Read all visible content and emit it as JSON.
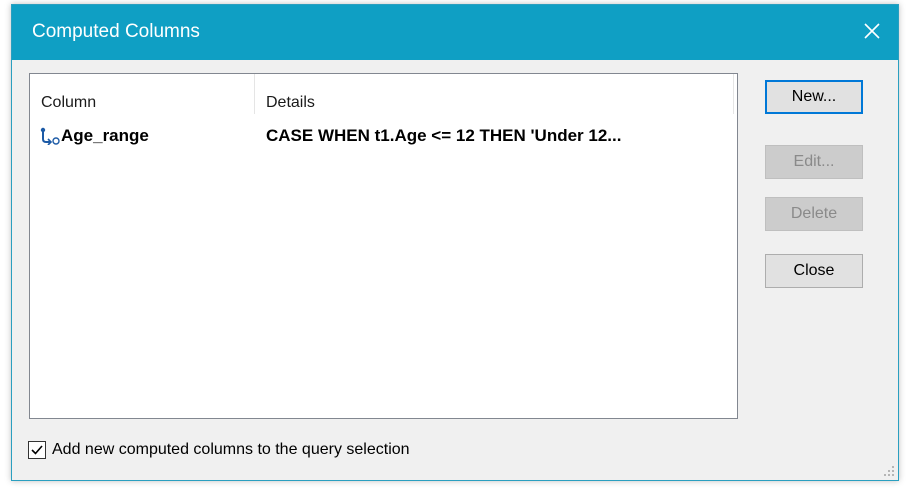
{
  "window": {
    "title": "Computed Columns",
    "titlebar_color": "#0f9fc4"
  },
  "list": {
    "columns": [
      "Column",
      "Details"
    ],
    "rows": [
      {
        "icon": "computed-column-icon",
        "column": "Age_range",
        "details": "CASE WHEN t1.Age <= 12 THEN 'Under 12..."
      }
    ]
  },
  "buttons": {
    "new": "New...",
    "edit": "Edit...",
    "delete": "Delete",
    "close": "Close"
  },
  "options": {
    "add_to_selection_label": "Add new computed columns to the query selection",
    "add_to_selection_checked": true
  }
}
